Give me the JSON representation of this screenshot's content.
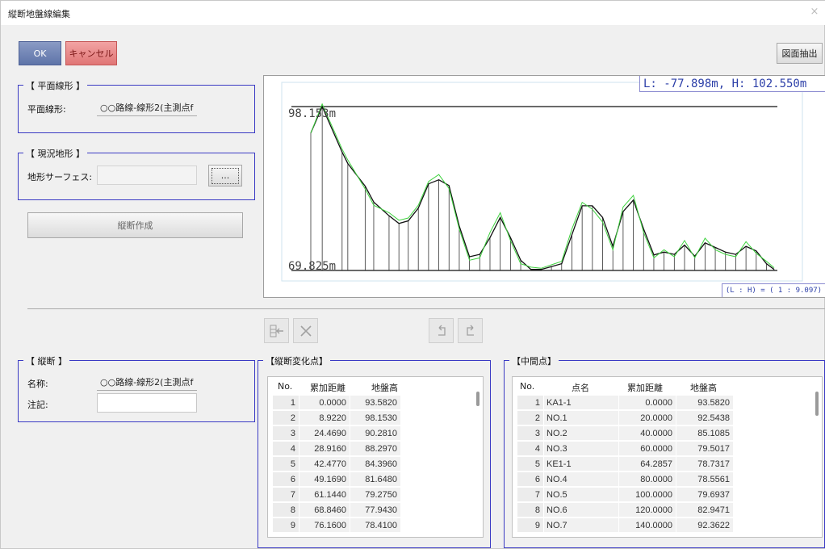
{
  "window": {
    "title": "縦断地盤線編集",
    "close": "×"
  },
  "buttons": {
    "ok": "OK",
    "cancel": "キャンセル",
    "extract": "図面抽出",
    "create_profile": "縦断作成",
    "browse": "..."
  },
  "plan_alignment": {
    "group": "【 平面線形 】",
    "label": "平面線形:",
    "value": "○○路線-線形2(主測点f"
  },
  "terrain": {
    "group": "【 現況地形 】",
    "label": "地形サーフェス:",
    "value": ""
  },
  "profile": {
    "group": "【 縦断 】",
    "name_label": "名称:",
    "name_value": "○○路線-線形2(主測点f",
    "note_label": "注記:",
    "note_value": ""
  },
  "chart": {
    "readout": "L:   -77.898m, H:   102.550m",
    "max_label": "98.153m",
    "min_label": "69.825m",
    "ratio": "(L : H) = ( 1 : 9.097)"
  },
  "toolbar_icons": [
    "insert-row-icon",
    "delete-icon",
    "undo-icon",
    "redo-icon"
  ],
  "change_points": {
    "group": "【縦断変化点】",
    "columns": [
      "No.",
      "累加距離",
      "地盤高"
    ],
    "rows": [
      [
        "1",
        "0.0000",
        "93.5820"
      ],
      [
        "2",
        "8.9220",
        "98.1530"
      ],
      [
        "3",
        "24.4690",
        "90.2810"
      ],
      [
        "4",
        "28.9160",
        "88.2970"
      ],
      [
        "5",
        "42.4770",
        "84.3960"
      ],
      [
        "6",
        "49.1690",
        "81.6480"
      ],
      [
        "7",
        "61.1440",
        "79.2750"
      ],
      [
        "8",
        "68.8460",
        "77.9430"
      ],
      [
        "9",
        "76.1600",
        "78.4100"
      ]
    ]
  },
  "intermediate_points": {
    "group": "【中間点】",
    "columns": [
      "No.",
      "点名",
      "累加距離",
      "地盤高"
    ],
    "rows": [
      [
        "1",
        "KA1-1",
        "0.0000",
        "93.5820"
      ],
      [
        "2",
        "NO.1",
        "20.0000",
        "92.5438"
      ],
      [
        "3",
        "NO.2",
        "40.0000",
        "85.1085"
      ],
      [
        "4",
        "NO.3",
        "60.0000",
        "79.5017"
      ],
      [
        "5",
        "KE1-1",
        "64.2857",
        "78.7317"
      ],
      [
        "6",
        "NO.4",
        "80.0000",
        "78.5561"
      ],
      [
        "7",
        "NO.5",
        "100.0000",
        "79.6937"
      ],
      [
        "8",
        "NO.6",
        "120.0000",
        "82.9471"
      ],
      [
        "9",
        "NO.7",
        "140.0000",
        "92.3622"
      ]
    ]
  },
  "chart_data": {
    "type": "line",
    "y_max": 98.153,
    "y_min": 69.825,
    "series": [
      {
        "color": "#111111",
        "x": [
          0,
          8.922,
          24.469,
          28.916,
          42.477,
          49.169,
          61.144,
          68.846,
          76.16,
          84,
          92,
          100,
          108,
          116,
          124,
          132,
          140,
          148,
          156,
          164,
          172,
          180,
          188,
          196,
          204,
          212,
          220,
          228,
          236,
          244,
          252,
          260,
          268,
          276,
          284,
          292,
          300,
          308,
          316,
          324,
          332,
          340,
          348,
          356,
          362
        ],
        "y": [
          93.582,
          98.153,
          90.281,
          88.297,
          84.396,
          81.648,
          79.275,
          77.943,
          78.41,
          80.6,
          84.8,
          85.5,
          84.5,
          77.5,
          72.2,
          72.6,
          75.5,
          79.0,
          75.5,
          71.6,
          70.0,
          70.0,
          70.5,
          71.0,
          76.0,
          81.0,
          81.0,
          79.0,
          74.0,
          80.0,
          82.0,
          77.0,
          72.5,
          73.0,
          72.6,
          74.2,
          72.3,
          74.6,
          73.8,
          73.0,
          72.6,
          74.0,
          73.2,
          71.0,
          70.0
        ]
      },
      {
        "color": "#3fd23f",
        "x": [
          0,
          8.922,
          24.469,
          28.916,
          42.477,
          49.169,
          61.144,
          68.846,
          76.16,
          84,
          92,
          100,
          108,
          116,
          124,
          132,
          140,
          148,
          156,
          164,
          172,
          180,
          188,
          196,
          204,
          212,
          220,
          228,
          236,
          244,
          252,
          260,
          268,
          276,
          284,
          292,
          300,
          308,
          316,
          324,
          332,
          340,
          348,
          356,
          362
        ],
        "y": [
          93.582,
          98.6,
          90.8,
          88.9,
          83.9,
          81.1,
          79.8,
          78.5,
          78.9,
          81.1,
          85.2,
          86.4,
          84.0,
          77.0,
          71.6,
          72.0,
          76.4,
          79.8,
          75.0,
          71.0,
          70.4,
          70.2,
          70.8,
          71.4,
          77.0,
          81.6,
          80.4,
          78.2,
          73.4,
          80.8,
          82.8,
          76.4,
          72.0,
          73.4,
          72.2,
          75.0,
          72.0,
          75.4,
          73.4,
          72.6,
          72.2,
          74.8,
          72.8,
          71.4,
          70.3
        ]
      }
    ]
  }
}
